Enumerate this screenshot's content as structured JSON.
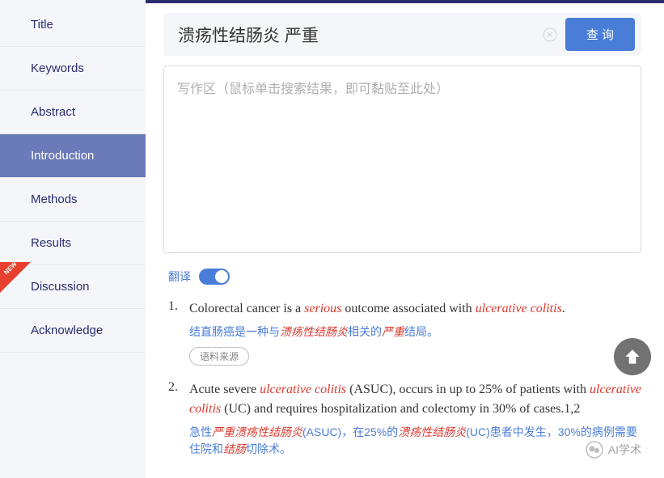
{
  "sidebar": {
    "items": [
      {
        "label": "Title"
      },
      {
        "label": "Keywords"
      },
      {
        "label": "Abstract"
      },
      {
        "label": "Introduction"
      },
      {
        "label": "Methods"
      },
      {
        "label": "Results"
      },
      {
        "label": "Discussion"
      },
      {
        "label": "Acknowledge"
      }
    ],
    "new_badge": "NEW"
  },
  "search": {
    "value": "溃疡性结肠炎 严重",
    "query_btn": "查 询"
  },
  "write_area": {
    "placeholder": "写作区（鼠标单击搜索结果，即可黏贴至此处）"
  },
  "translate": {
    "label": "翻译",
    "enabled": true
  },
  "results": [
    {
      "num": "1.",
      "en_pre": "Colorectal cancer is a ",
      "en_hl1": "serious",
      "en_mid": " outcome associated with ",
      "en_hl2": "ulcerative colitis",
      "en_post": ".",
      "zh_pre": "结直肠癌是一种与",
      "zh_hl1": "溃疡性结肠炎",
      "zh_mid": "相关的",
      "zh_hl2": "严重",
      "zh_post": "结局。",
      "source_btn": "语料来源"
    },
    {
      "num": "2.",
      "en_pre": "Acute severe ",
      "en_hl1": "ulcerative colitis",
      "en_mid": " (ASUC), occurs in up to 25% of patients with ",
      "en_hl2": "ulcerative colitis",
      "en_post": " (UC) and requires hospitalization and colectomy in 30% of cases.1,2",
      "zh_pre": "急性",
      "zh_hl0": "严重溃疡性结肠炎",
      "zh_mid1": "(ASUC)，在25%的",
      "zh_hl1": "溃疡性结肠炎",
      "zh_mid2": "(UC)患者中发生，30%的病例需要住院和",
      "zh_hl2": "结肠",
      "zh_post": "切除术。"
    }
  ],
  "watermark": "AI学术"
}
